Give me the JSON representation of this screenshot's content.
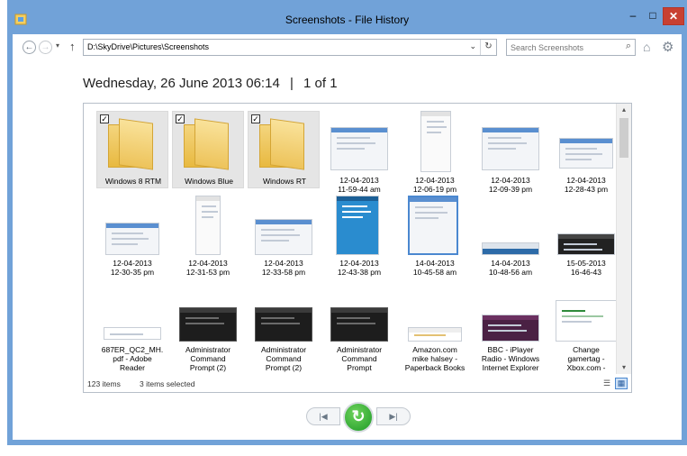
{
  "window": {
    "title": "Screenshots - File History",
    "minimize_glyph": "–",
    "maximize_glyph": "□",
    "close_glyph": "✕"
  },
  "nav": {
    "back_glyph": "←",
    "forward_glyph": "→",
    "dropdown_glyph": "▾",
    "up_glyph": "↑",
    "address": "D:\\SkyDrive\\Pictures\\Screenshots",
    "address_dropdown_glyph": "⌄",
    "refresh_glyph": "↻",
    "search_placeholder": "Search Screenshots",
    "search_glyph": "⌕",
    "home_glyph": "⌂",
    "settings_glyph": "⚙"
  },
  "heading": {
    "date": "Wednesday, 26 June 2013 06:14",
    "separator": "|",
    "position": "1 of 1"
  },
  "items": [
    {
      "label": "Windows 8 RTM",
      "kind": "folder",
      "checked": true
    },
    {
      "label": "Windows Blue",
      "kind": "folder",
      "checked": true
    },
    {
      "label": "Windows RT",
      "kind": "folder",
      "checked": true
    },
    {
      "label": "12-04-2013\n11-59-44 am",
      "kind": "screenshot"
    },
    {
      "label": "12-04-2013\n12-06-19 pm",
      "kind": "screenshot"
    },
    {
      "label": "12-04-2013\n12-09-39 pm",
      "kind": "screenshot"
    },
    {
      "label": "12-04-2013\n12-28-43 pm",
      "kind": "screenshot"
    },
    {
      "label": "12-04-2013\n12-30-35 pm",
      "kind": "screenshot"
    },
    {
      "label": "12-04-2013\n12-31-53 pm",
      "kind": "screenshot"
    },
    {
      "label": "12-04-2013\n12-33-58 pm",
      "kind": "screenshot"
    },
    {
      "label": "12-04-2013\n12-43-38 pm",
      "kind": "screenshot"
    },
    {
      "label": "14-04-2013\n10-45-58 am",
      "kind": "screenshot"
    },
    {
      "label": "14-04-2013\n10-48-56 am",
      "kind": "screenshot"
    },
    {
      "label": "15-05-2013\n16-46-43",
      "kind": "screenshot"
    },
    {
      "label": "687ER_QC2_MH.\npdf - Adobe\nReader",
      "kind": "screenshot"
    },
    {
      "label": "Administrator\nCommand\nPrompt (2)",
      "kind": "screenshot"
    },
    {
      "label": "Administrator\nCommand\nPrompt (2)",
      "kind": "screenshot"
    },
    {
      "label": "Administrator\nCommand\nPrompt",
      "kind": "screenshot"
    },
    {
      "label": "Amazon.com\nmike halsey -\nPaperback Books",
      "kind": "screenshot"
    },
    {
      "label": "BBC - iPlayer\nRadio - Windows\nInternet Explorer",
      "kind": "screenshot"
    },
    {
      "label": "Change\ngamertag -\nXbox.com -",
      "kind": "screenshot"
    }
  ],
  "checkbox_glyph": "✓",
  "scroll": {
    "up_glyph": "▴",
    "down_glyph": "▾"
  },
  "status": {
    "count": "123 items",
    "selected": "3 items selected",
    "details_glyph": "☰",
    "tiles_glyph": "▦"
  },
  "playback": {
    "prev_glyph": "|◀",
    "restore_glyph": "↻",
    "next_glyph": "▶|"
  }
}
